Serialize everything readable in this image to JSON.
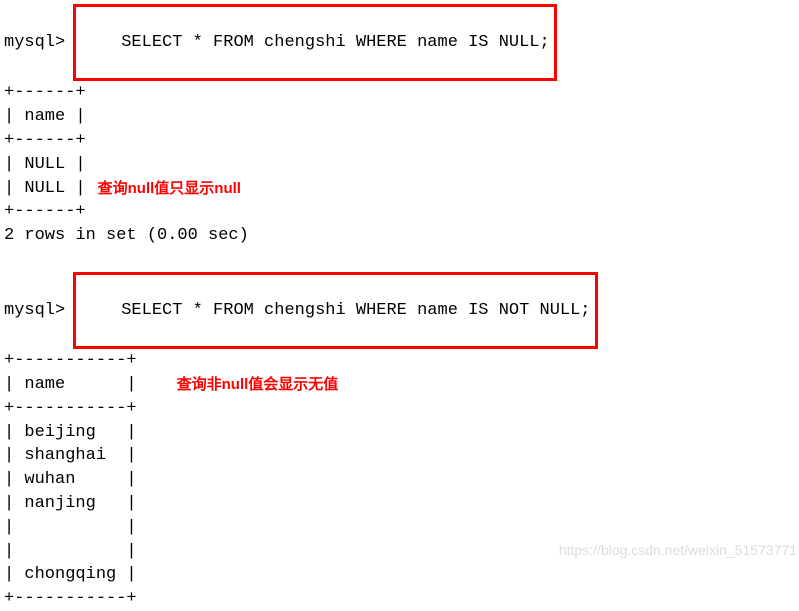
{
  "query1": {
    "prompt": "mysql>",
    "sql": "SELECT * FROM chengshi WHERE name IS NULL;",
    "separator": "+------+",
    "header": "| name |",
    "rows": [
      "| NULL |",
      "| NULL |"
    ],
    "footer": "2 rows in set (0.00 sec)"
  },
  "annotation1": "查询null值只显示null",
  "query2": {
    "prompt": "mysql>",
    "sql": "SELECT * FROM chengshi WHERE name IS NOT NULL;",
    "separator": "+-----------+",
    "header": "| name      |",
    "rows": [
      "| beijing   |",
      "| shanghai  |",
      "| wuhan     |",
      "| nanjing   |",
      "|           |",
      "|           |",
      "| chongqing |"
    ]
  },
  "annotation2": "查询非null值会显示无值",
  "watermark": "https://blog.csdn.net/weixin_51573771"
}
